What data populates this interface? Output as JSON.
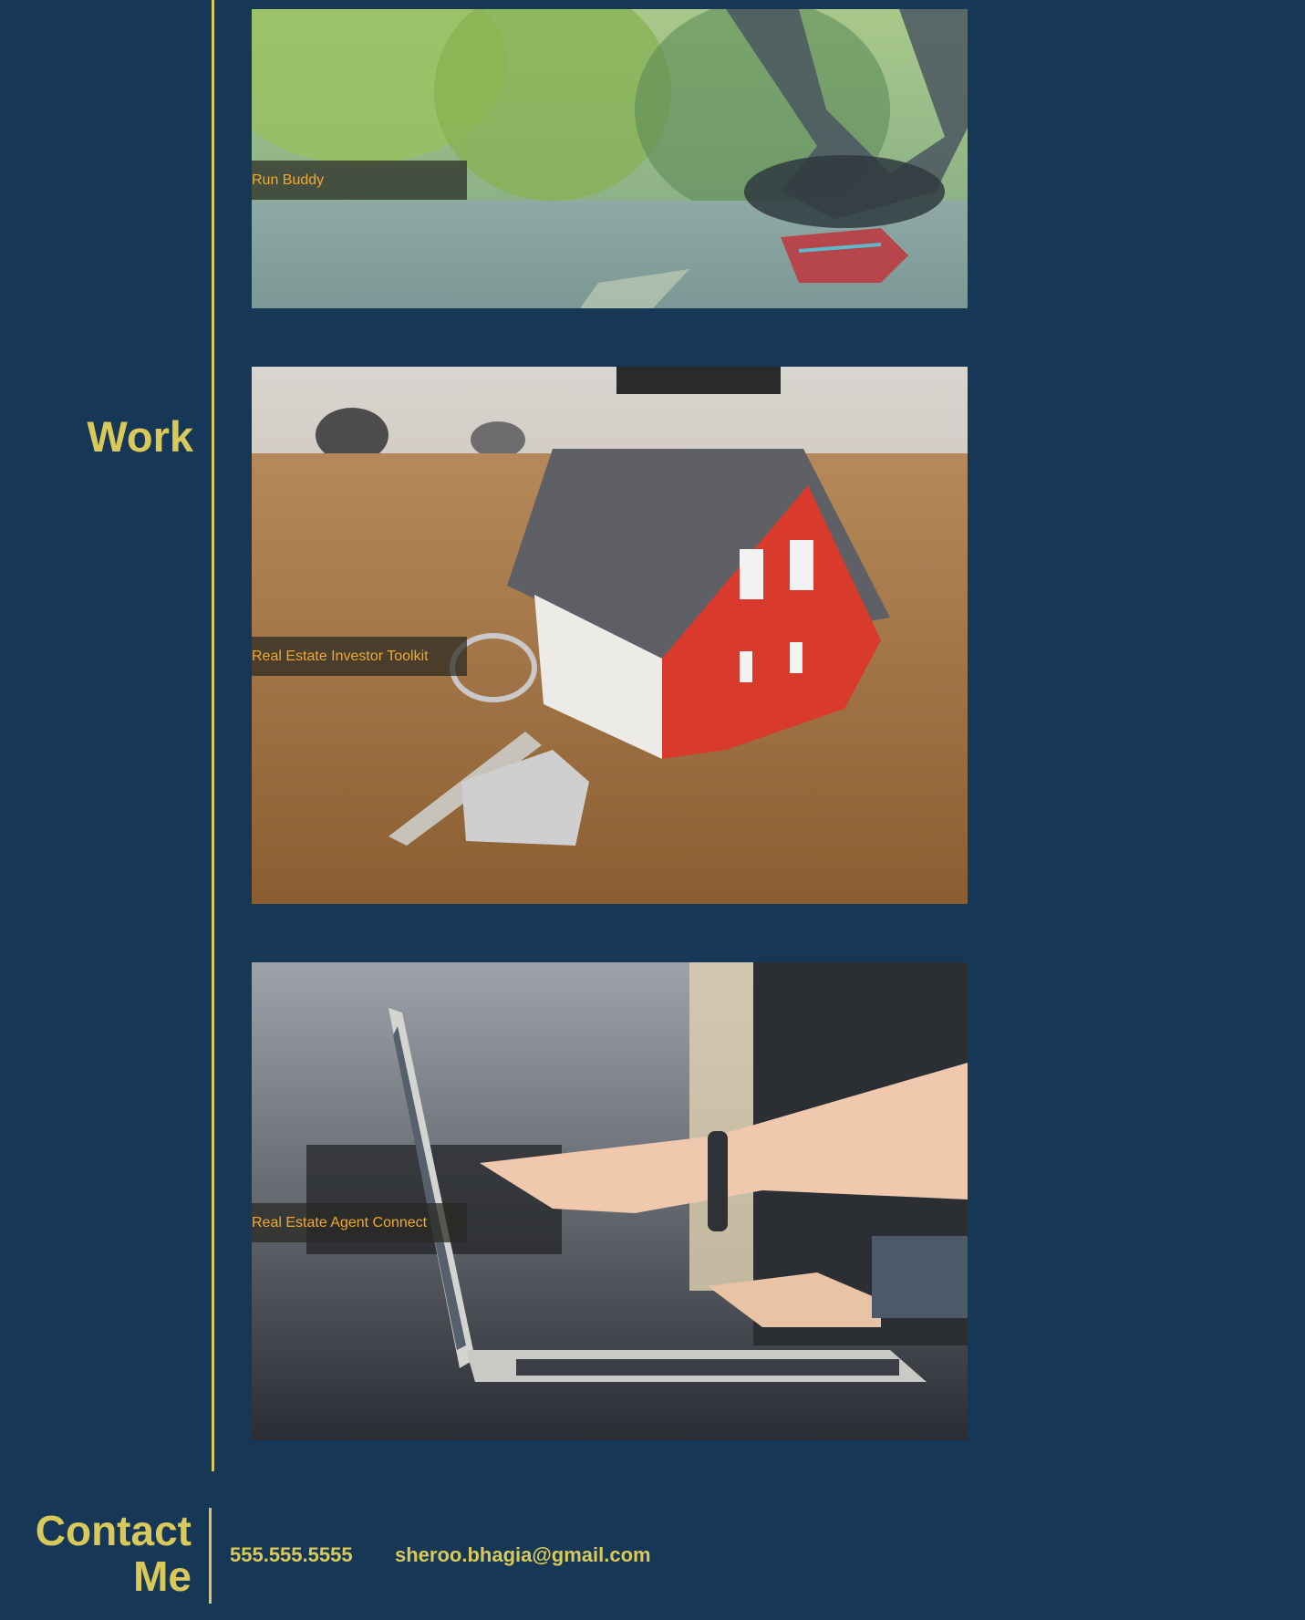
{
  "work": {
    "heading": "Work",
    "projects": [
      {
        "title": "Run Buddy",
        "image": "runner-tying-shoe-photo"
      },
      {
        "title": "Real Estate Investor Toolkit",
        "image": "model-house-with-keys-photo"
      },
      {
        "title": "Real Estate Agent Connect",
        "image": "hands-pointing-at-laptop-photo"
      }
    ]
  },
  "contact": {
    "heading_line1": "Contact",
    "heading_line2": "Me",
    "phone": "555.555.5555",
    "email": "sheroo.bhagia@gmail.com"
  },
  "colors": {
    "background": "#173756",
    "accent": "#d9c95a",
    "label_text": "#f0a82e"
  }
}
